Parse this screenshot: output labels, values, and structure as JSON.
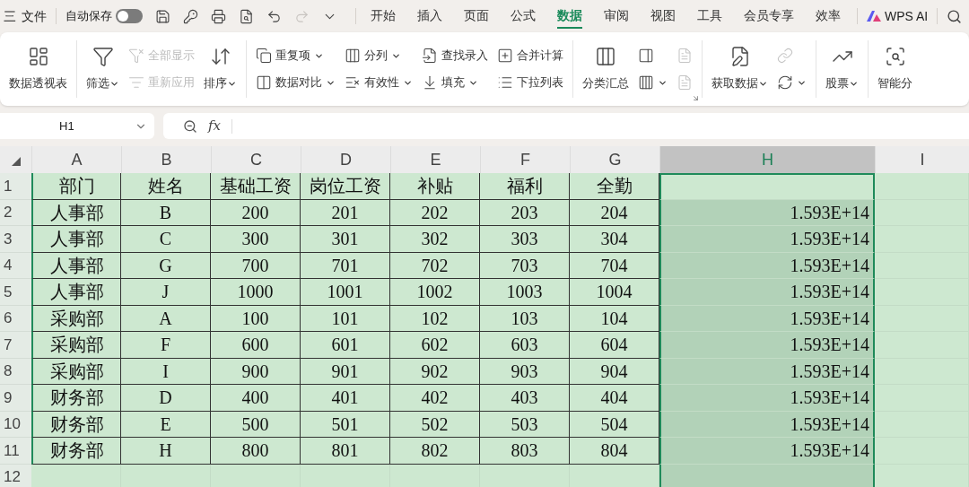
{
  "menu": {
    "glyph": "三",
    "file": "文件",
    "autosave": {
      "label": "自动保存",
      "on": false
    },
    "quick_actions": [
      {
        "disabled": false
      },
      {
        "disabled": false
      },
      {
        "disabled": false
      },
      {
        "disabled": false
      },
      {
        "disabled": false
      },
      {
        "disabled": true
      },
      {
        "disabled": false
      }
    ]
  },
  "tabs": [
    {
      "label": "开始",
      "selected": false
    },
    {
      "label": "插入",
      "selected": false
    },
    {
      "label": "页面",
      "selected": false
    },
    {
      "label": "公式",
      "selected": false
    },
    {
      "label": "数据",
      "selected": true
    },
    {
      "label": "审阅",
      "selected": false
    },
    {
      "label": "视图",
      "selected": false
    },
    {
      "label": "工具",
      "selected": false
    },
    {
      "label": "会员专享",
      "selected": false
    },
    {
      "label": "效率",
      "selected": false
    }
  ],
  "ai_button": "WPS AI",
  "ribbon": [
    {
      "columns": [
        {
          "kind": "large",
          "items": [
            {
              "label": "数据透视表",
              "disabled": false,
              "dropdown": false
            }
          ]
        }
      ]
    },
    {
      "columns": [
        {
          "kind": "large",
          "items": [
            {
              "label": "筛选",
              "disabled": false,
              "dropdown": true
            }
          ]
        },
        {
          "kind": "stack",
          "items": [
            {
              "label": "全部显示",
              "disabled": true,
              "dropdown": false
            },
            {
              "label": "重新应用",
              "disabled": true,
              "dropdown": false
            }
          ]
        },
        {
          "kind": "large",
          "items": [
            {
              "label": "排序",
              "disabled": false,
              "dropdown": true
            }
          ]
        }
      ]
    },
    {
      "columns": [
        {
          "kind": "stack",
          "items": [
            {
              "label": "重复项",
              "disabled": false,
              "dropdown": true
            },
            {
              "label": "数据对比",
              "disabled": false,
              "dropdown": true
            }
          ]
        },
        {
          "kind": "stack",
          "items": [
            {
              "label": "分列",
              "disabled": false,
              "dropdown": true
            },
            {
              "label": "有效性",
              "disabled": false,
              "dropdown": true
            }
          ]
        },
        {
          "kind": "stack",
          "items": [
            {
              "label": "查找录入",
              "disabled": false,
              "dropdown": false
            },
            {
              "label": "填充",
              "disabled": false,
              "dropdown": true
            }
          ]
        },
        {
          "kind": "stack",
          "items": [
            {
              "label": "合并计算",
              "disabled": false,
              "dropdown": false
            },
            {
              "label": "下拉列表",
              "disabled": false,
              "dropdown": false
            }
          ]
        }
      ]
    },
    {
      "launcher": true,
      "columns": [
        {
          "kind": "large",
          "items": [
            {
              "label": "分类汇总",
              "disabled": false,
              "dropdown": false
            }
          ]
        },
        {
          "kind": "stack",
          "items": [
            {
              "disabled": false,
              "dropdown": false
            },
            {
              "disabled": false,
              "dropdown": true
            }
          ]
        },
        {
          "kind": "stack",
          "items": [
            {
              "disabled": true,
              "dropdown": false
            },
            {
              "disabled": true,
              "dropdown": false
            }
          ]
        }
      ]
    },
    {
      "columns": [
        {
          "kind": "large",
          "items": [
            {
              "label": "获取数据",
              "disabled": false,
              "dropdown": true
            }
          ]
        },
        {
          "kind": "stack",
          "items": [
            {
              "disabled": true,
              "dropdown": false
            },
            {
              "disabled": false,
              "dropdown": true
            }
          ]
        }
      ]
    },
    {
      "columns": [
        {
          "kind": "large",
          "items": [
            {
              "label": "股票",
              "disabled": false,
              "dropdown": true
            }
          ]
        }
      ]
    },
    {
      "columns": [
        {
          "kind": "large",
          "items": [
            {
              "label": "智能分",
              "disabled": false,
              "dropdown": false
            }
          ]
        }
      ]
    }
  ],
  "formula_bar": {
    "name_box": "H1",
    "fx": "fx"
  },
  "sheet": {
    "columns": [
      {
        "label": "A",
        "selected": false
      },
      {
        "label": "B",
        "selected": false
      },
      {
        "label": "C",
        "selected": false
      },
      {
        "label": "D",
        "selected": false
      },
      {
        "label": "E",
        "selected": false
      },
      {
        "label": "F",
        "selected": false
      },
      {
        "label": "G",
        "selected": false
      },
      {
        "label": "H",
        "selected": true
      },
      {
        "label": "I",
        "selected": false
      }
    ],
    "rows": [
      {
        "label": "1",
        "cells": [
          "部门",
          "姓名",
          "基础工资",
          "岗位工资",
          "补贴",
          "福利",
          "全勤",
          null
        ]
      },
      {
        "label": "2",
        "cells": [
          "人事部",
          "B",
          "200",
          "201",
          "202",
          "203",
          "204",
          "1.593E+14"
        ]
      },
      {
        "label": "3",
        "cells": [
          "人事部",
          "C",
          "300",
          "301",
          "302",
          "303",
          "304",
          "1.593E+14"
        ]
      },
      {
        "label": "4",
        "cells": [
          "人事部",
          "G",
          "700",
          "701",
          "702",
          "703",
          "704",
          "1.593E+14"
        ]
      },
      {
        "label": "5",
        "cells": [
          "人事部",
          "J",
          "1000",
          "1001",
          "1002",
          "1003",
          "1004",
          "1.593E+14"
        ]
      },
      {
        "label": "6",
        "cells": [
          "采购部",
          "A",
          "100",
          "101",
          "102",
          "103",
          "104",
          "1.593E+14"
        ]
      },
      {
        "label": "7",
        "cells": [
          "采购部",
          "F",
          "600",
          "601",
          "602",
          "603",
          "604",
          "1.593E+14"
        ]
      },
      {
        "label": "8",
        "cells": [
          "采购部",
          "I",
          "900",
          "901",
          "902",
          "903",
          "904",
          "1.593E+14"
        ]
      },
      {
        "label": "9",
        "cells": [
          "财务部",
          "D",
          "400",
          "401",
          "402",
          "403",
          "404",
          "1.593E+14"
        ]
      },
      {
        "label": "10",
        "cells": [
          "财务部",
          "E",
          "500",
          "501",
          "502",
          "503",
          "504",
          "1.593E+14"
        ]
      },
      {
        "label": "11",
        "cells": [
          "财务部",
          "H",
          "800",
          "801",
          "802",
          "803",
          "804",
          "1.593E+14"
        ]
      },
      {
        "label": "12",
        "cells": []
      }
    ]
  }
}
